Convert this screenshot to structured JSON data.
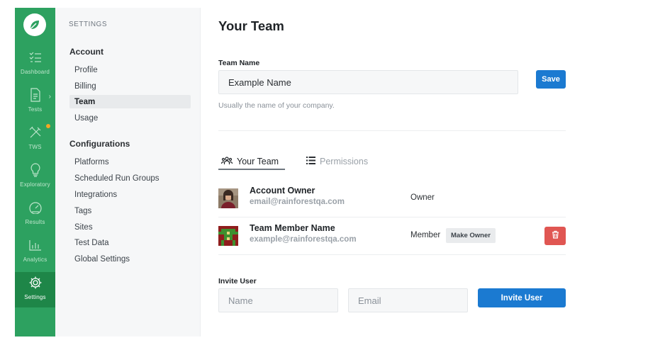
{
  "rail": {
    "logo_icon": "leaf-icon",
    "items": [
      {
        "label": "Dashboard",
        "icon": "checklist-icon"
      },
      {
        "label": "Tests",
        "icon": "document-icon"
      },
      {
        "label": "TWS",
        "icon": "tools-icon"
      },
      {
        "label": "Exploratory",
        "icon": "lightbulb-icon"
      },
      {
        "label": "Results",
        "icon": "gauge-icon"
      },
      {
        "label": "Analytics",
        "icon": "bar-chart-icon"
      },
      {
        "label": "Settings",
        "icon": "gear-icon"
      }
    ],
    "active": "Settings",
    "accent": "#2da160",
    "badge_color": "#f5a623"
  },
  "subnav": {
    "caption": "SETTINGS",
    "account_heading": "Account",
    "account_items": [
      "Profile",
      "Billing",
      "Team",
      "Usage"
    ],
    "config_heading": "Configurations",
    "config_items": [
      "Platforms",
      "Scheduled Run Groups",
      "Integrations",
      "Tags",
      "Sites",
      "Test Data",
      "Global Settings"
    ],
    "active_item": "Team"
  },
  "main": {
    "title": "Your Team",
    "team_name_label": "Team Name",
    "team_name_value": "Example Name",
    "save_label": "Save",
    "team_name_hint": "Usually the name of your company.",
    "tabs": [
      {
        "label": "Your Team",
        "icon": "users-icon",
        "active": true
      },
      {
        "label": "Permissions",
        "icon": "list-icon",
        "active": false
      }
    ],
    "members": [
      {
        "name": "Account Owner",
        "email": "email@rainforestqa.com",
        "role": "Owner",
        "avatar": "photo-avatar"
      },
      {
        "name": "Team Member Name",
        "email": "example@rainforestqa.com",
        "role": "Member",
        "avatar": "pixel-avatar",
        "make_owner_label": "Make Owner",
        "delete_icon": "trash-icon"
      }
    ],
    "invite_label": "Invite User",
    "invite_name_placeholder": "Name",
    "invite_email_placeholder": "Email",
    "invite_button_label": "Invite User",
    "button_color": "#1b7ad1",
    "delete_color": "#e05652"
  }
}
